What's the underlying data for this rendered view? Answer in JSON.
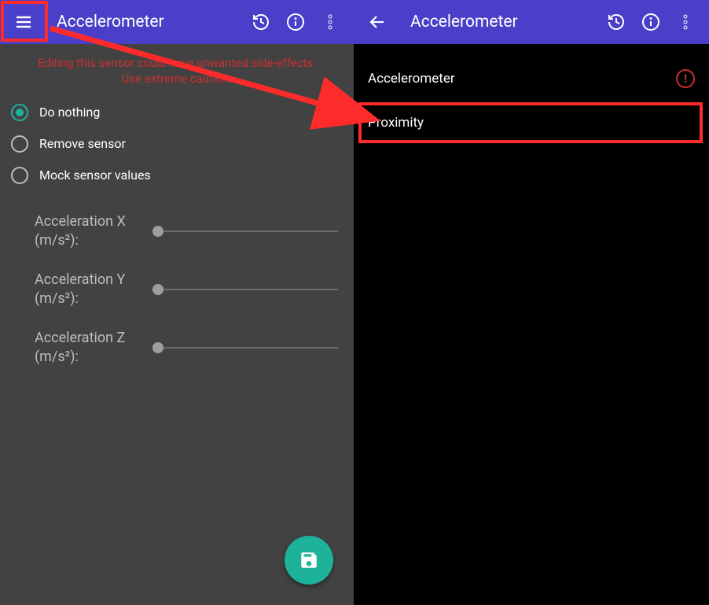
{
  "left": {
    "title": "Accelerometer",
    "warning_line1": "Editing this sensor could have unwanted side-effects.",
    "warning_line2": "Use extreme caution.",
    "radios": {
      "do_nothing": "Do nothing",
      "remove_sensor": "Remove sensor",
      "mock_values": "Mock sensor values"
    },
    "sliders": {
      "x": "Acceleration X (m/s²):",
      "y": "Acceleration Y (m/s²):",
      "z": "Acceleration Z (m/s²):"
    }
  },
  "right": {
    "title": "Accelerometer",
    "items": {
      "accelerometer": "Accelerometer",
      "proximity": "Proximity"
    },
    "warn_glyph": "!"
  }
}
